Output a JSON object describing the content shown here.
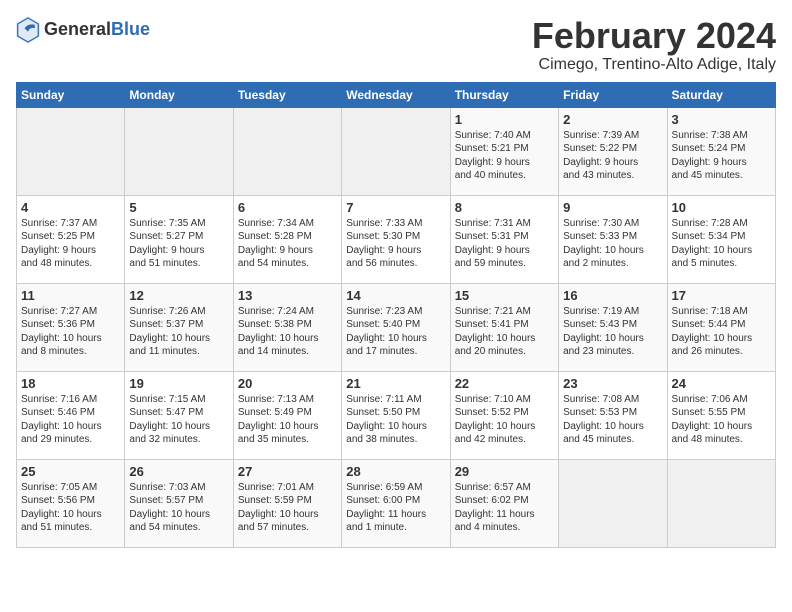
{
  "header": {
    "logo_general": "General",
    "logo_blue": "Blue",
    "title": "February 2024",
    "subtitle": "Cimego, Trentino-Alto Adige, Italy"
  },
  "calendar": {
    "days_of_week": [
      "Sunday",
      "Monday",
      "Tuesday",
      "Wednesday",
      "Thursday",
      "Friday",
      "Saturday"
    ],
    "weeks": [
      [
        {
          "day": "",
          "info": ""
        },
        {
          "day": "",
          "info": ""
        },
        {
          "day": "",
          "info": ""
        },
        {
          "day": "",
          "info": ""
        },
        {
          "day": "1",
          "info": "Sunrise: 7:40 AM\nSunset: 5:21 PM\nDaylight: 9 hours\nand 40 minutes."
        },
        {
          "day": "2",
          "info": "Sunrise: 7:39 AM\nSunset: 5:22 PM\nDaylight: 9 hours\nand 43 minutes."
        },
        {
          "day": "3",
          "info": "Sunrise: 7:38 AM\nSunset: 5:24 PM\nDaylight: 9 hours\nand 45 minutes."
        }
      ],
      [
        {
          "day": "4",
          "info": "Sunrise: 7:37 AM\nSunset: 5:25 PM\nDaylight: 9 hours\nand 48 minutes."
        },
        {
          "day": "5",
          "info": "Sunrise: 7:35 AM\nSunset: 5:27 PM\nDaylight: 9 hours\nand 51 minutes."
        },
        {
          "day": "6",
          "info": "Sunrise: 7:34 AM\nSunset: 5:28 PM\nDaylight: 9 hours\nand 54 minutes."
        },
        {
          "day": "7",
          "info": "Sunrise: 7:33 AM\nSunset: 5:30 PM\nDaylight: 9 hours\nand 56 minutes."
        },
        {
          "day": "8",
          "info": "Sunrise: 7:31 AM\nSunset: 5:31 PM\nDaylight: 9 hours\nand 59 minutes."
        },
        {
          "day": "9",
          "info": "Sunrise: 7:30 AM\nSunset: 5:33 PM\nDaylight: 10 hours\nand 2 minutes."
        },
        {
          "day": "10",
          "info": "Sunrise: 7:28 AM\nSunset: 5:34 PM\nDaylight: 10 hours\nand 5 minutes."
        }
      ],
      [
        {
          "day": "11",
          "info": "Sunrise: 7:27 AM\nSunset: 5:36 PM\nDaylight: 10 hours\nand 8 minutes."
        },
        {
          "day": "12",
          "info": "Sunrise: 7:26 AM\nSunset: 5:37 PM\nDaylight: 10 hours\nand 11 minutes."
        },
        {
          "day": "13",
          "info": "Sunrise: 7:24 AM\nSunset: 5:38 PM\nDaylight: 10 hours\nand 14 minutes."
        },
        {
          "day": "14",
          "info": "Sunrise: 7:23 AM\nSunset: 5:40 PM\nDaylight: 10 hours\nand 17 minutes."
        },
        {
          "day": "15",
          "info": "Sunrise: 7:21 AM\nSunset: 5:41 PM\nDaylight: 10 hours\nand 20 minutes."
        },
        {
          "day": "16",
          "info": "Sunrise: 7:19 AM\nSunset: 5:43 PM\nDaylight: 10 hours\nand 23 minutes."
        },
        {
          "day": "17",
          "info": "Sunrise: 7:18 AM\nSunset: 5:44 PM\nDaylight: 10 hours\nand 26 minutes."
        }
      ],
      [
        {
          "day": "18",
          "info": "Sunrise: 7:16 AM\nSunset: 5:46 PM\nDaylight: 10 hours\nand 29 minutes."
        },
        {
          "day": "19",
          "info": "Sunrise: 7:15 AM\nSunset: 5:47 PM\nDaylight: 10 hours\nand 32 minutes."
        },
        {
          "day": "20",
          "info": "Sunrise: 7:13 AM\nSunset: 5:49 PM\nDaylight: 10 hours\nand 35 minutes."
        },
        {
          "day": "21",
          "info": "Sunrise: 7:11 AM\nSunset: 5:50 PM\nDaylight: 10 hours\nand 38 minutes."
        },
        {
          "day": "22",
          "info": "Sunrise: 7:10 AM\nSunset: 5:52 PM\nDaylight: 10 hours\nand 42 minutes."
        },
        {
          "day": "23",
          "info": "Sunrise: 7:08 AM\nSunset: 5:53 PM\nDaylight: 10 hours\nand 45 minutes."
        },
        {
          "day": "24",
          "info": "Sunrise: 7:06 AM\nSunset: 5:55 PM\nDaylight: 10 hours\nand 48 minutes."
        }
      ],
      [
        {
          "day": "25",
          "info": "Sunrise: 7:05 AM\nSunset: 5:56 PM\nDaylight: 10 hours\nand 51 minutes."
        },
        {
          "day": "26",
          "info": "Sunrise: 7:03 AM\nSunset: 5:57 PM\nDaylight: 10 hours\nand 54 minutes."
        },
        {
          "day": "27",
          "info": "Sunrise: 7:01 AM\nSunset: 5:59 PM\nDaylight: 10 hours\nand 57 minutes."
        },
        {
          "day": "28",
          "info": "Sunrise: 6:59 AM\nSunset: 6:00 PM\nDaylight: 11 hours\nand 1 minute."
        },
        {
          "day": "29",
          "info": "Sunrise: 6:57 AM\nSunset: 6:02 PM\nDaylight: 11 hours\nand 4 minutes."
        },
        {
          "day": "",
          "info": ""
        },
        {
          "day": "",
          "info": ""
        }
      ]
    ]
  }
}
